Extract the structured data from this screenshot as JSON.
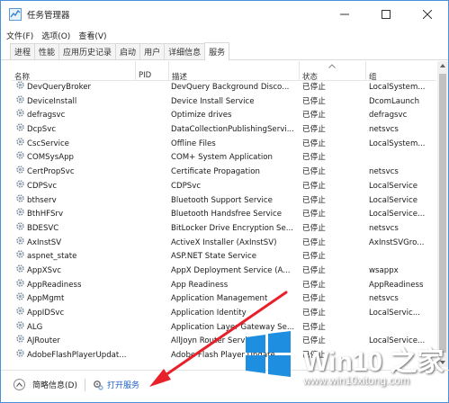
{
  "window": {
    "title": "任务管理器"
  },
  "menu": [
    "文件(F)",
    "选项(O)",
    "查看(V)"
  ],
  "tabs": [
    {
      "label": "进程",
      "active": false
    },
    {
      "label": "性能",
      "active": false
    },
    {
      "label": "应用历史记录",
      "active": false
    },
    {
      "label": "启动",
      "active": false
    },
    {
      "label": "用户",
      "active": false
    },
    {
      "label": "详细信息",
      "active": false
    },
    {
      "label": "服务",
      "active": true
    }
  ],
  "columns": {
    "name": "名称",
    "pid": "PID",
    "desc": "描述",
    "status": "状态",
    "group": "组"
  },
  "rows": [
    {
      "name": "DevQueryBroker",
      "pid": "",
      "desc": "DevQuery Background Disco...",
      "status": "已停止",
      "group": "LocalSystem..."
    },
    {
      "name": "DeviceInstall",
      "pid": "",
      "desc": "Device Install Service",
      "status": "已停止",
      "group": "DcomLaunch"
    },
    {
      "name": "defragsvc",
      "pid": "",
      "desc": "Optimize drives",
      "status": "已停止",
      "group": "defragsvc"
    },
    {
      "name": "DcpSvc",
      "pid": "",
      "desc": "DataCollectionPublishingServi...",
      "status": "已停止",
      "group": "netsvcs"
    },
    {
      "name": "CscService",
      "pid": "",
      "desc": "Offline Files",
      "status": "已停止",
      "group": "LocalSystem..."
    },
    {
      "name": "COMSysApp",
      "pid": "",
      "desc": "COM+ System Application",
      "status": "已停止",
      "group": ""
    },
    {
      "name": "CertPropSvc",
      "pid": "",
      "desc": "Certificate Propagation",
      "status": "已停止",
      "group": "netsvcs"
    },
    {
      "name": "CDPSvc",
      "pid": "",
      "desc": "CDPSvc",
      "status": "已停止",
      "group": "LocalService"
    },
    {
      "name": "bthserv",
      "pid": "",
      "desc": "Bluetooth Support Service",
      "status": "已停止",
      "group": "LocalService"
    },
    {
      "name": "BthHFSrv",
      "pid": "",
      "desc": "Bluetooth Handsfree Service",
      "status": "已停止",
      "group": "LocalService..."
    },
    {
      "name": "BDESVC",
      "pid": "",
      "desc": "BitLocker Drive Encryption Se...",
      "status": "已停止",
      "group": "netsvcs"
    },
    {
      "name": "AxInstSV",
      "pid": "",
      "desc": "ActiveX Installer (AxInstSV)",
      "status": "已停止",
      "group": "AxInstSVGro..."
    },
    {
      "name": "aspnet_state",
      "pid": "",
      "desc": "ASP.NET State Service",
      "status": "已停止",
      "group": ""
    },
    {
      "name": "AppXSvc",
      "pid": "",
      "desc": "AppX Deployment Service (A...",
      "status": "已停止",
      "group": "wsappx"
    },
    {
      "name": "AppReadiness",
      "pid": "",
      "desc": "App Readiness",
      "status": "已停止",
      "group": "AppReadiness"
    },
    {
      "name": "AppMgmt",
      "pid": "",
      "desc": "Application Management",
      "status": "已停止",
      "group": "netsvcs"
    },
    {
      "name": "AppIDSvc",
      "pid": "",
      "desc": "Application Identity",
      "status": "已停止",
      "group": "LocalServic..."
    },
    {
      "name": "ALG",
      "pid": "",
      "desc": "Application Layer Gateway Se...",
      "status": "已停止",
      "group": ""
    },
    {
      "name": "AJRouter",
      "pid": "",
      "desc": "AllJoyn Router Service",
      "status": "已停止",
      "group": "LocalService..."
    },
    {
      "name": "AdobeFlashPlayerUpdat...",
      "pid": "",
      "desc": "Adobe Flash Player Update...",
      "status": "已停止",
      "group": ""
    }
  ],
  "footer": {
    "fewer_details": "简略信息(D)",
    "open_services": "打开服务"
  },
  "watermark": {
    "title": "Win10 之家",
    "url": "www.win10xitong.com"
  },
  "colors": {
    "accent": "#1f5fbf",
    "annotation": "#e8202a",
    "window_border": "#4a90d9",
    "logo_blue": "#1e8fe0"
  },
  "icons": {
    "app": "task-manager-icon",
    "service": "gear-icon",
    "open_services": "services-icon"
  }
}
